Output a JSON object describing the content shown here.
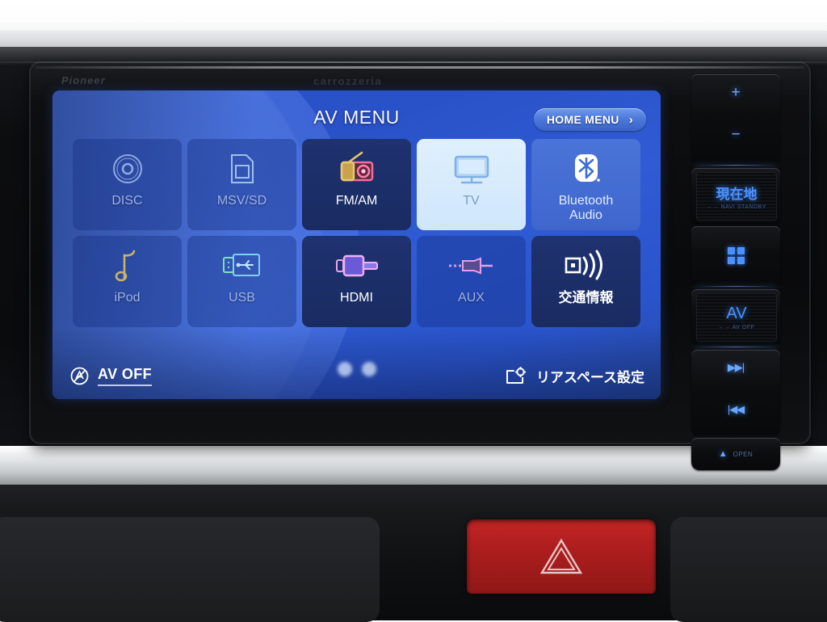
{
  "device": {
    "brand_left": "Pioneer",
    "brand_right": "carrozzeria"
  },
  "screen": {
    "title": "AV MENU",
    "home_menu": {
      "label": "HOME MENU",
      "chevron": "›"
    },
    "page_dots": 2,
    "av_off": {
      "label": "AV OFF",
      "icon": "av-off-icon"
    },
    "rear_space": {
      "label": "リアスペース設定",
      "icon": "rear-space-gear-icon"
    },
    "tiles": [
      {
        "id": "disc",
        "label": "DISC",
        "icon": "disc-icon",
        "state": "disabled"
      },
      {
        "id": "msv-sd",
        "label": "MSV/SD",
        "icon": "sdcard-icon",
        "state": "disabled"
      },
      {
        "id": "fm-am",
        "label": "FM/AM",
        "icon": "radio-icon",
        "state": "enabled"
      },
      {
        "id": "tv",
        "label": "TV",
        "icon": "tv-icon",
        "state": "selected"
      },
      {
        "id": "bt-audio",
        "label": "Bluetooth\nAudio",
        "icon": "bluetooth-icon",
        "state": "highlight"
      },
      {
        "id": "ipod",
        "label": "iPod",
        "icon": "music-note-icon",
        "state": "disabled"
      },
      {
        "id": "usb",
        "label": "USB",
        "icon": "usb-icon",
        "state": "disabled"
      },
      {
        "id": "hdmi",
        "label": "HDMI",
        "icon": "hdmi-icon",
        "state": "enabled"
      },
      {
        "id": "aux",
        "label": "AUX",
        "icon": "aux-plug-icon",
        "state": "disabled"
      },
      {
        "id": "traffic",
        "label": "交通情報",
        "icon": "traffic-signal-icon",
        "state": "enabled"
      }
    ]
  },
  "hardware_buttons": {
    "volume_up": "+",
    "volume_down": "−",
    "current_location": {
      "main": "現在地",
      "sub": "←→ NAVI STANDBY"
    },
    "menu_grid": "menu-grid-icon",
    "av": {
      "main": "AV",
      "sub": "←→ AV OFF"
    },
    "track_next": "▶▶|",
    "track_prev": "|◀◀",
    "eject": {
      "symbol": "▲",
      "label": "OPEN"
    }
  },
  "dashboard": {
    "hazard_button": "hazard-warning-icon"
  },
  "colors": {
    "screen_blue": "#2f5bd4",
    "tile_enabled": "#1e3270",
    "tile_selected": "#dff0fd",
    "accent_cyan": "#6aa6ff",
    "hazard_red": "#b82020"
  }
}
